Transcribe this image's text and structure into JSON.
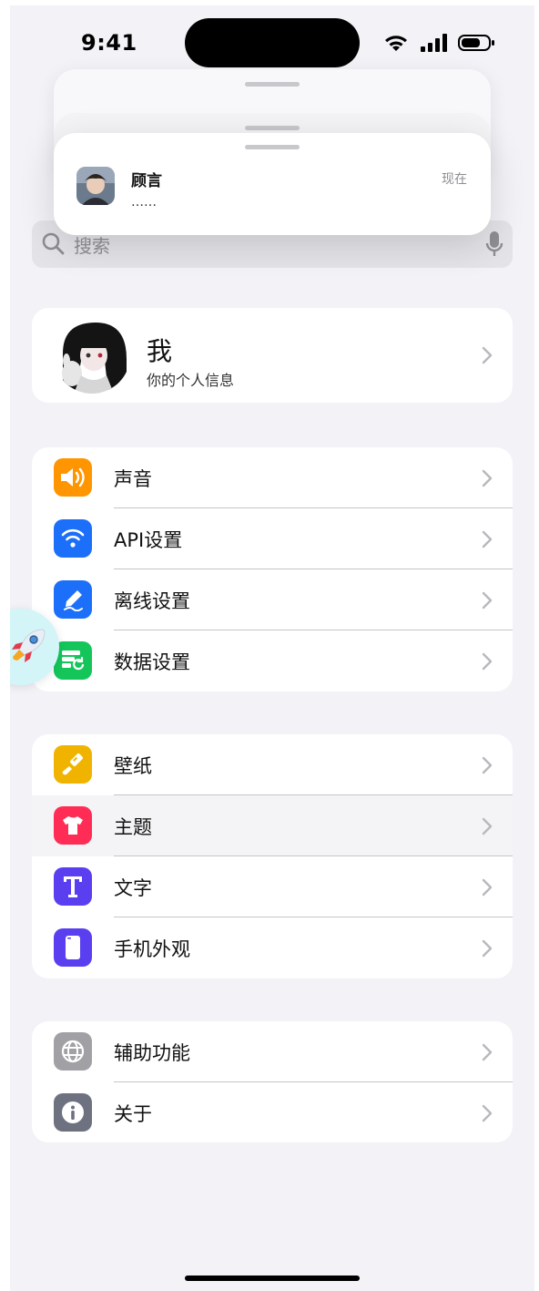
{
  "status_bar": {
    "time": "9:41"
  },
  "notification": {
    "name": "顾言",
    "time": "现在",
    "message": "……"
  },
  "search": {
    "placeholder": "搜索"
  },
  "profile": {
    "name": "我",
    "subtitle": "你的个人信息"
  },
  "groups": [
    {
      "items": [
        {
          "label": "声音",
          "icon": "speaker-icon",
          "color": "#ff9500"
        },
        {
          "label": "API设置",
          "icon": "wifi-icon",
          "color": "#1c6ff8"
        },
        {
          "label": "离线设置",
          "icon": "pen-icon",
          "color": "#1c6ff8"
        },
        {
          "label": "数据设置",
          "icon": "database-refresh-icon",
          "color": "#14c65a"
        }
      ]
    },
    {
      "items": [
        {
          "label": "壁纸",
          "icon": "brush-icon",
          "color": "#f0b400"
        },
        {
          "label": "主题",
          "icon": "shirt-icon",
          "color": "#ff2d55"
        },
        {
          "label": "文字",
          "icon": "text-icon",
          "color": "#5a3ff0"
        },
        {
          "label": "手机外观",
          "icon": "phone-icon",
          "color": "#5a3ff0"
        }
      ]
    },
    {
      "items": [
        {
          "label": "辅助功能",
          "icon": "globe-icon",
          "color": "#a0a0a5"
        },
        {
          "label": "关于",
          "icon": "info-icon",
          "color": "#6e7280"
        }
      ]
    }
  ]
}
